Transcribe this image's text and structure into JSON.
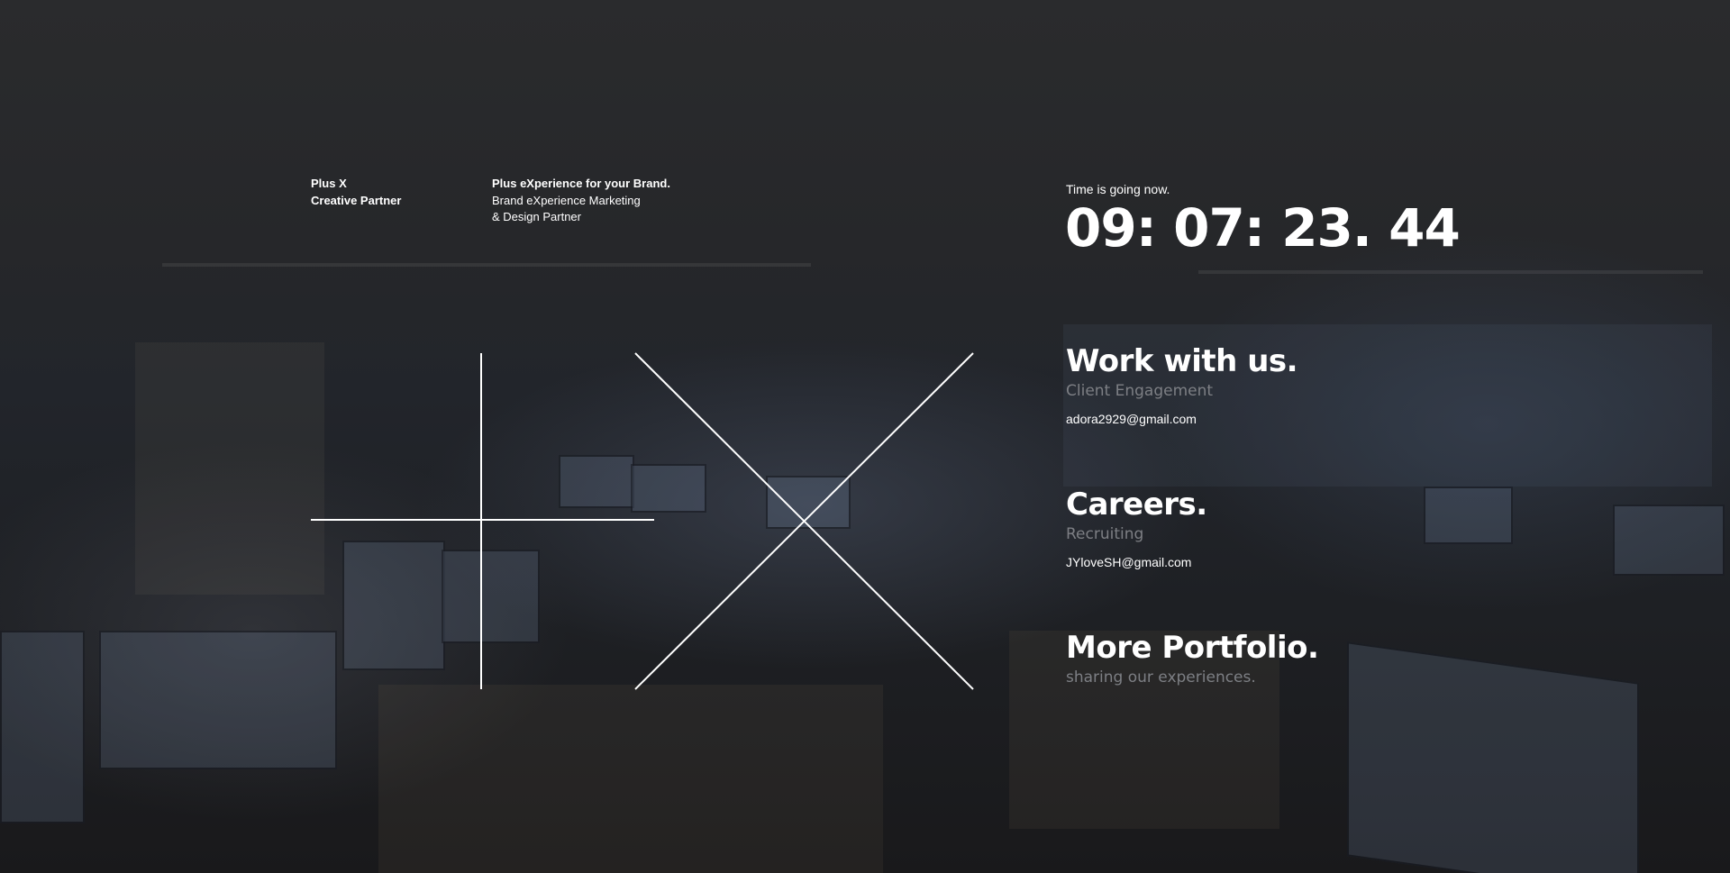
{
  "brand": {
    "name": "Plus X",
    "role": "Creative Partner",
    "tagline": "Plus eXperience for your Brand.",
    "desc_line1": "Brand eXperience Marketing",
    "desc_line2": "& Design Partner"
  },
  "clock": {
    "caption": "Time is going now.",
    "value": "09: 07: 23. 44"
  },
  "sections": {
    "work": {
      "title": "Work with us.",
      "subtitle": "Client Engagement",
      "email": "adora2929@gmail.com"
    },
    "careers": {
      "title": "Careers.",
      "subtitle": "Recruiting",
      "email": "JYloveSH@gmail.com"
    },
    "portfolio": {
      "title": "More Portfolio.",
      "subtitle": "sharing our experiences."
    }
  },
  "colors": {
    "text": "#ffffff",
    "muted": "#7d7f84",
    "background": "#1b1d21"
  }
}
